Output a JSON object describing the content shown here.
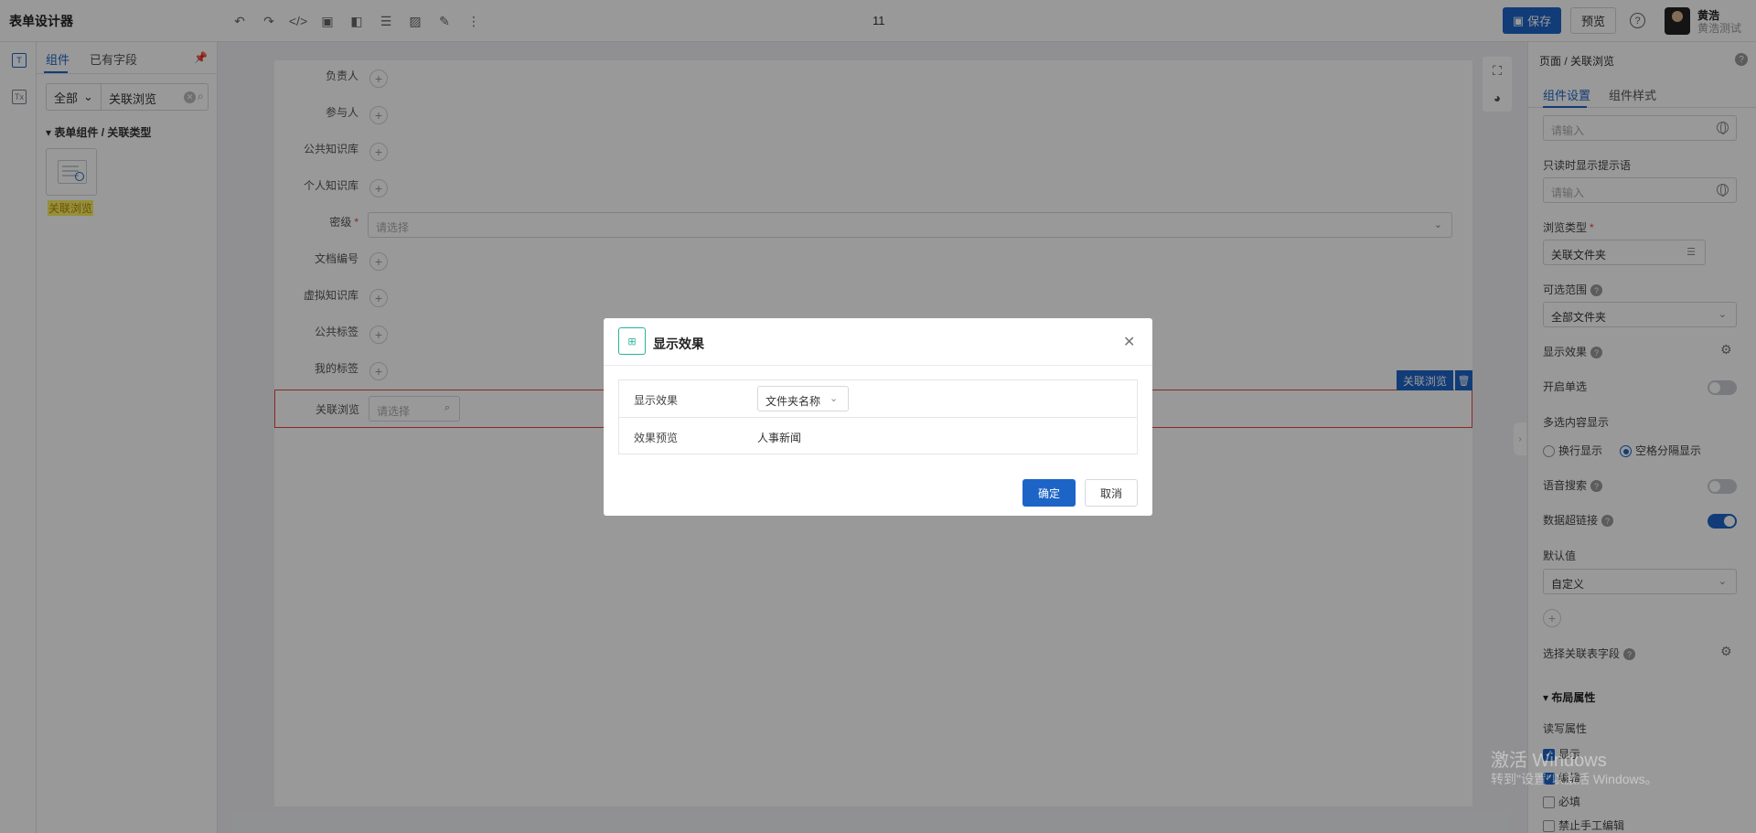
{
  "app": {
    "title": "表单设计器",
    "doc_name": "11"
  },
  "toolbar": {
    "icons": [
      "undo-icon",
      "redo-icon",
      "code-icon",
      "image-icon",
      "layout-icon",
      "list-icon",
      "picture-icon",
      "form-icon",
      "more-icon"
    ],
    "save_label": "保存",
    "preview_label": "预览"
  },
  "user": {
    "name": "黄浩",
    "sub": "黄浩测试"
  },
  "left_panel": {
    "tabs": [
      "组件",
      "已有字段"
    ],
    "filter_select": "全部",
    "filter_value": "关联浏览",
    "group_title": "表单组件 / 关联类型",
    "component_label": "关联浏览"
  },
  "canvas": {
    "rows": [
      {
        "label": "负责人"
      },
      {
        "label": "参与人"
      },
      {
        "label": "公共知识库"
      },
      {
        "label": "个人知识库"
      },
      {
        "label": "密级",
        "placeholder": "请选择"
      },
      {
        "label": "文档编号"
      },
      {
        "label": "虚拟知识库"
      },
      {
        "label": "公共标签"
      },
      {
        "label": "我的标签"
      },
      {
        "label": "关联浏览",
        "placeholder": "请选择"
      }
    ],
    "selected_tag": "关联浏览"
  },
  "right_panel": {
    "breadcrumb": "页面 / 关联浏览",
    "tabs": [
      "组件设置",
      "组件样式"
    ],
    "input1_placeholder": "请输入",
    "readonly_label": "只读时显示提示语",
    "input2_placeholder": "请输入",
    "browse_type_label": "浏览类型",
    "browse_type_value": "关联文件夹",
    "range_label": "可选范围",
    "range_value": "全部文件夹",
    "display_label": "显示效果",
    "single_label": "开启单选",
    "multi_label": "多选内容显示",
    "radio_line": "换行显示",
    "radio_space": "空格分隔显示",
    "voice_label": "语音搜索",
    "hyperlink_label": "数据超链接",
    "default_label": "默认值",
    "default_value": "自定义",
    "assoc_field_label": "选择关联表字段",
    "layout_section": "布局属性",
    "rw_label": "读写属性",
    "checks": [
      "显示",
      "编辑",
      "必填",
      "禁止手工编辑"
    ]
  },
  "modal": {
    "title": "显示效果",
    "rows": [
      {
        "label": "显示效果",
        "value": "文件夹名称"
      },
      {
        "label": "效果预览",
        "value": "人事新闻"
      }
    ],
    "ok_label": "确定",
    "cancel_label": "取消"
  },
  "watermark": {
    "line1": "激活 Windows",
    "line2": "转到\"设置\"以激活 Windows。"
  }
}
